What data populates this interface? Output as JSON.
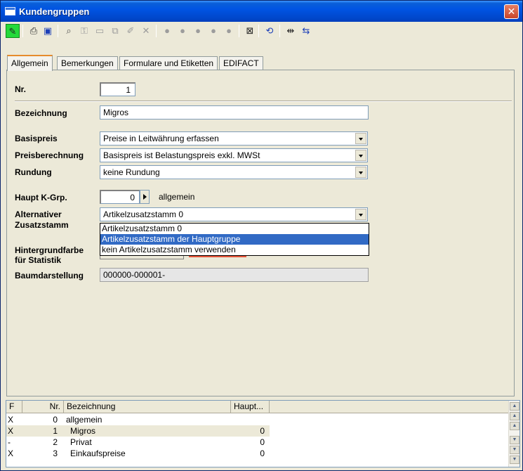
{
  "window": {
    "title": "Kundengruppen",
    "close_glyph": "✕"
  },
  "toolbar": [
    {
      "name": "edit-pencil-icon",
      "glyph": "✎",
      "state": "active"
    },
    {
      "name": "print-icon",
      "glyph": "⎙",
      "state": "normal"
    },
    {
      "name": "save-disk-icon",
      "glyph": "▣",
      "state": "blue"
    },
    {
      "name": "search-binoculars-icon",
      "glyph": "⌕",
      "state": "dark"
    },
    {
      "name": "key-icon",
      "glyph": "⚿",
      "state": "disabled"
    },
    {
      "name": "new-document-icon",
      "glyph": "▭",
      "state": "disabled"
    },
    {
      "name": "copy-icon",
      "glyph": "⧉",
      "state": "disabled"
    },
    {
      "name": "pen-edit-icon",
      "glyph": "✐",
      "state": "disabled"
    },
    {
      "name": "delete-icon",
      "glyph": "✕",
      "state": "disabled"
    },
    {
      "name": "record-first-icon",
      "glyph": "●",
      "state": "disabled"
    },
    {
      "name": "record-prev-icon",
      "glyph": "●",
      "state": "disabled"
    },
    {
      "name": "record-next-icon",
      "glyph": "●",
      "state": "disabled"
    },
    {
      "name": "record-last-icon",
      "glyph": "●",
      "state": "disabled"
    },
    {
      "name": "record-go-icon",
      "glyph": "●",
      "state": "disabled"
    },
    {
      "name": "filter-icon",
      "glyph": "⊠",
      "state": "normal"
    },
    {
      "name": "refresh-link-icon",
      "glyph": "⟲",
      "state": "blue"
    },
    {
      "name": "expand-width-icon",
      "glyph": "⇹",
      "state": "normal"
    },
    {
      "name": "collapse-width-icon",
      "glyph": "⇆",
      "state": "blue"
    }
  ],
  "tabs": [
    {
      "label": "Allgemein",
      "active": true
    },
    {
      "label": "Bemerkungen",
      "active": false
    },
    {
      "label": "Formulare und Etiketten",
      "active": false
    },
    {
      "label": "EDIFACT",
      "active": false
    }
  ],
  "form": {
    "nr_label": "Nr.",
    "nr_value": "1",
    "bezeichnung_label": "Bezeichnung",
    "bezeichnung_value": "Migros",
    "basispreis_label": "Basispreis",
    "basispreis_value": "Preise in Leitwährung erfassen",
    "preisberechnung_label": "Preisberechnung",
    "preisberechnung_value": "Basispreis ist Belastungspreis exkl. MWSt",
    "rundung_label": "Rundung",
    "rundung_value": "keine Rundung",
    "haupt_label": "Haupt K-Grp.",
    "haupt_value": "0",
    "haupt_name": "allgemein",
    "alt_label_1": "Alternativer",
    "alt_label_2": "Zusatzstamm",
    "alt_value": "Artikelzusatzstamm 0",
    "alt_options": [
      "Artikelzusatzstamm 0",
      "Artikelzusatzstamm der Hauptgruppe",
      "kein Artikelzusatzstamm verwenden"
    ],
    "alt_highlighted": 1,
    "hg_label_1": "Hintergrundfarbe",
    "hg_label_2": "für Statistik",
    "baum_label": "Baumdarstellung",
    "baum_value": "000000-000001-"
  },
  "grid": {
    "headers": {
      "f": "F",
      "nr": "Nr.",
      "bez": "Bezeichnung",
      "haupt": "Haupt..."
    },
    "rows": [
      {
        "f": "X",
        "nr": "0",
        "bez": "allgemein",
        "haupt": ""
      },
      {
        "f": "X",
        "nr": "1",
        "bez": "Migros",
        "haupt": "0"
      },
      {
        "f": "-",
        "nr": "2",
        "bez": "Privat",
        "haupt": "0"
      },
      {
        "f": "X",
        "nr": "3",
        "bez": "Einkaufspreise",
        "haupt": "0"
      }
    ]
  }
}
